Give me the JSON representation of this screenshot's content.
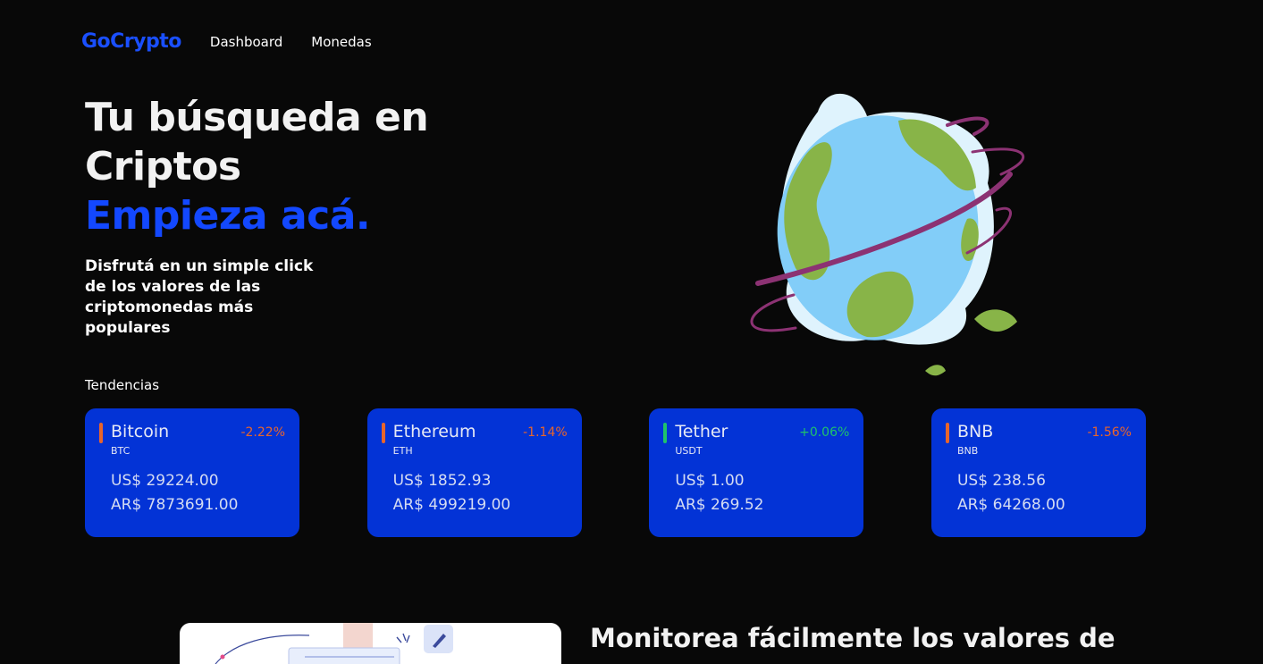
{
  "nav": {
    "logo": "GoCrypto",
    "links": [
      "Dashboard",
      "Monedas"
    ]
  },
  "hero": {
    "title_line1": "Tu búsqueda en",
    "title_line2": "Criptos",
    "title_accent": "Empieza acá.",
    "subtitle": "Disfrutá en un simple click de los valores de las criptomonedas más populares",
    "illustration": "globe-illustration"
  },
  "trends": {
    "label": "Tendencias",
    "cards": [
      {
        "name": "Bitcoin",
        "symbol": "BTC",
        "change": "-2.22%",
        "usd": "US$ 29224.00",
        "ars": "AR$ 7873691.00",
        "direction": "down"
      },
      {
        "name": "Ethereum",
        "symbol": "ETH",
        "change": "-1.14%",
        "usd": "US$ 1852.93",
        "ars": "AR$ 499219.00",
        "direction": "down"
      },
      {
        "name": "Tether",
        "symbol": "USDT",
        "change": "+0.06%",
        "usd": "US$ 1.00",
        "ars": "AR$ 269.52",
        "direction": "up"
      },
      {
        "name": "BNB",
        "symbol": "BNB",
        "change": "-1.56%",
        "usd": "US$ 238.56",
        "ars": "AR$ 64268.00",
        "direction": "down"
      }
    ]
  },
  "section2": {
    "title": "Monitorea fácilmente los valores de"
  },
  "colors": {
    "background": "#080808",
    "brand": "#1a4fff",
    "card": "#0333d6",
    "negative": "#e8652b",
    "positive": "#1fc36a"
  }
}
